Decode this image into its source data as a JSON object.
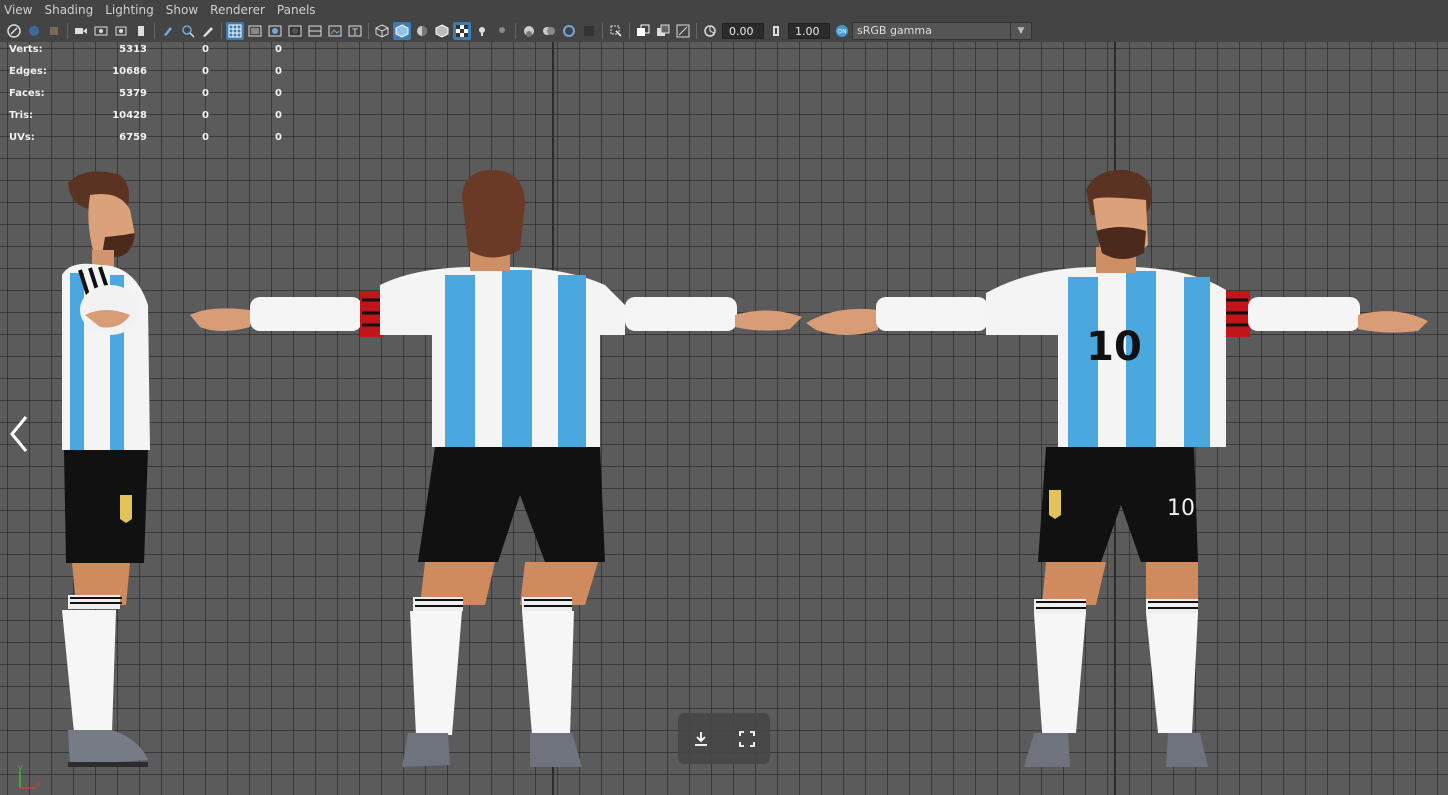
{
  "menu": {
    "items": [
      "View",
      "Shading",
      "Lighting",
      "Show",
      "Renderer",
      "Panels"
    ]
  },
  "toolbar": {
    "exposure": "0.00",
    "gamma": "1.00",
    "color_space": "sRGB gamma"
  },
  "hud": {
    "rows": [
      {
        "label": "Verts:",
        "v1": "5313",
        "v2": "0",
        "v3": "0"
      },
      {
        "label": "Edges:",
        "v1": "10686",
        "v2": "0",
        "v3": "0"
      },
      {
        "label": "Faces:",
        "v1": "5379",
        "v2": "0",
        "v3": "0"
      },
      {
        "label": "Tris:",
        "v1": "10428",
        "v2": "0",
        "v3": "0"
      },
      {
        "label": "UVs:",
        "v1": "6759",
        "v2": "0",
        "v3": "0"
      }
    ]
  },
  "character": {
    "jersey_number": "10",
    "shorts_number": "10"
  },
  "axis": {
    "y": "y",
    "x": "x"
  },
  "colors": {
    "jersey_blue": "#4aa7e0",
    "shorts": "#111111",
    "skin": "#e0a27c",
    "hair": "#5a3322",
    "armband": "#c3141a",
    "viewport_bg": "#5b5b5b"
  },
  "icons": [
    "prev-arrow-icon",
    "download-icon",
    "fullscreen-icon"
  ]
}
